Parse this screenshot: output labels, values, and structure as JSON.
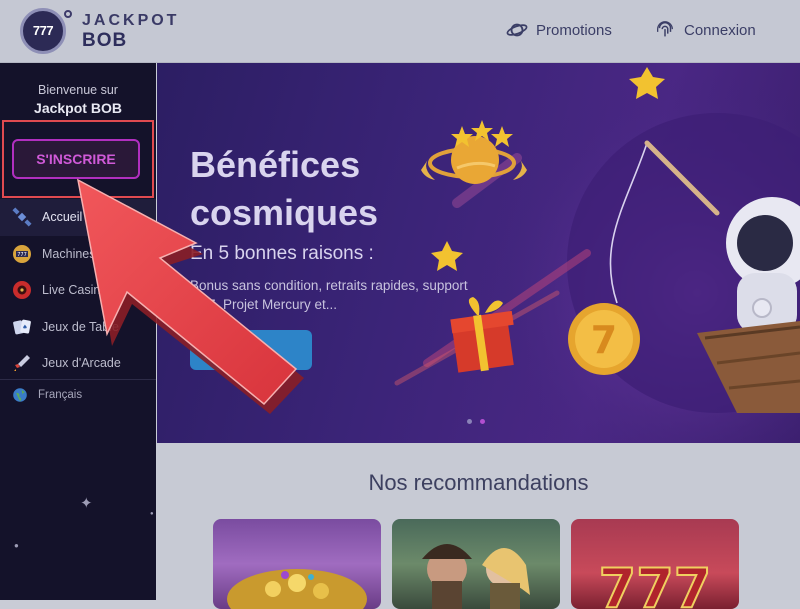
{
  "header": {
    "logo_badge": "777",
    "logo_line1": "JACKPOT",
    "logo_line2": "BOB",
    "nav": [
      {
        "label": "Promotions",
        "icon": "planet-icon"
      },
      {
        "label": "Connexion",
        "icon": "fingerprint-icon"
      }
    ]
  },
  "sidebar": {
    "welcome": "Bienvenue sur",
    "brand": "Jackpot BOB",
    "signup_label": "S'INSCRIRE",
    "items": [
      {
        "label": "Accueil",
        "icon": "satellite-icon",
        "active": true
      },
      {
        "label": "Machines",
        "icon": "slot-machine-icon"
      },
      {
        "label": "Live Casino",
        "icon": "roulette-icon"
      },
      {
        "label": "Jeux de Table",
        "icon": "cards-icon"
      },
      {
        "label": "Jeux d'Arcade",
        "icon": "rocket-icon"
      }
    ],
    "language": "Français",
    "language_icon": "globe-icon"
  },
  "hero": {
    "title": "Bénéfices cosmiques",
    "subtitle": "En 5 bonnes raisons :",
    "text": "Bonus sans condition, retraits rapides, support 7J/7, Projet Mercury et...",
    "button": "VOIR +",
    "coin_label": "7",
    "slide_count": 2,
    "active_slide": 2
  },
  "recommendations": {
    "title": "Nos recommandations"
  },
  "colors": {
    "highlight": "#e04a50",
    "signup": "#b12fbf",
    "hero_button": "#2d84c8",
    "sidebar_bg": "#14122a"
  }
}
